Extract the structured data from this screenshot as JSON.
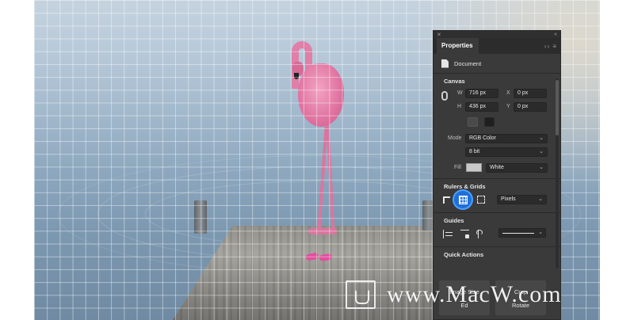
{
  "panel": {
    "tab_label": "Properties",
    "menu_icon": "hamburger-menu-icon",
    "document_label": "Document",
    "canvas": {
      "heading": "Canvas",
      "w_label": "W",
      "w_value": "716 px",
      "h_label": "H",
      "h_value": "436 px",
      "x_label": "X",
      "x_value": "0 px",
      "y_label": "Y",
      "y_value": "0 px",
      "mode_label": "Mode",
      "mode_value": "RGB Color",
      "bit_value": "8 bit",
      "fill_label": "Fill",
      "fill_value": "White",
      "fill_color": "#c9c9c9"
    },
    "rulers_grids": {
      "heading": "Rulers & Grids",
      "units_value": "Pixels",
      "grid_active_color": "#1f6fd9"
    },
    "guides": {
      "heading": "Guides"
    },
    "quick_actions": {
      "heading": "Quick Actions",
      "btn1_label": "Image Size",
      "btn1_sub": "Ed",
      "btn2_label": "Crop",
      "btn2_sub": "Rotate"
    }
  },
  "watermark": {
    "text": "www.MacW.com"
  }
}
